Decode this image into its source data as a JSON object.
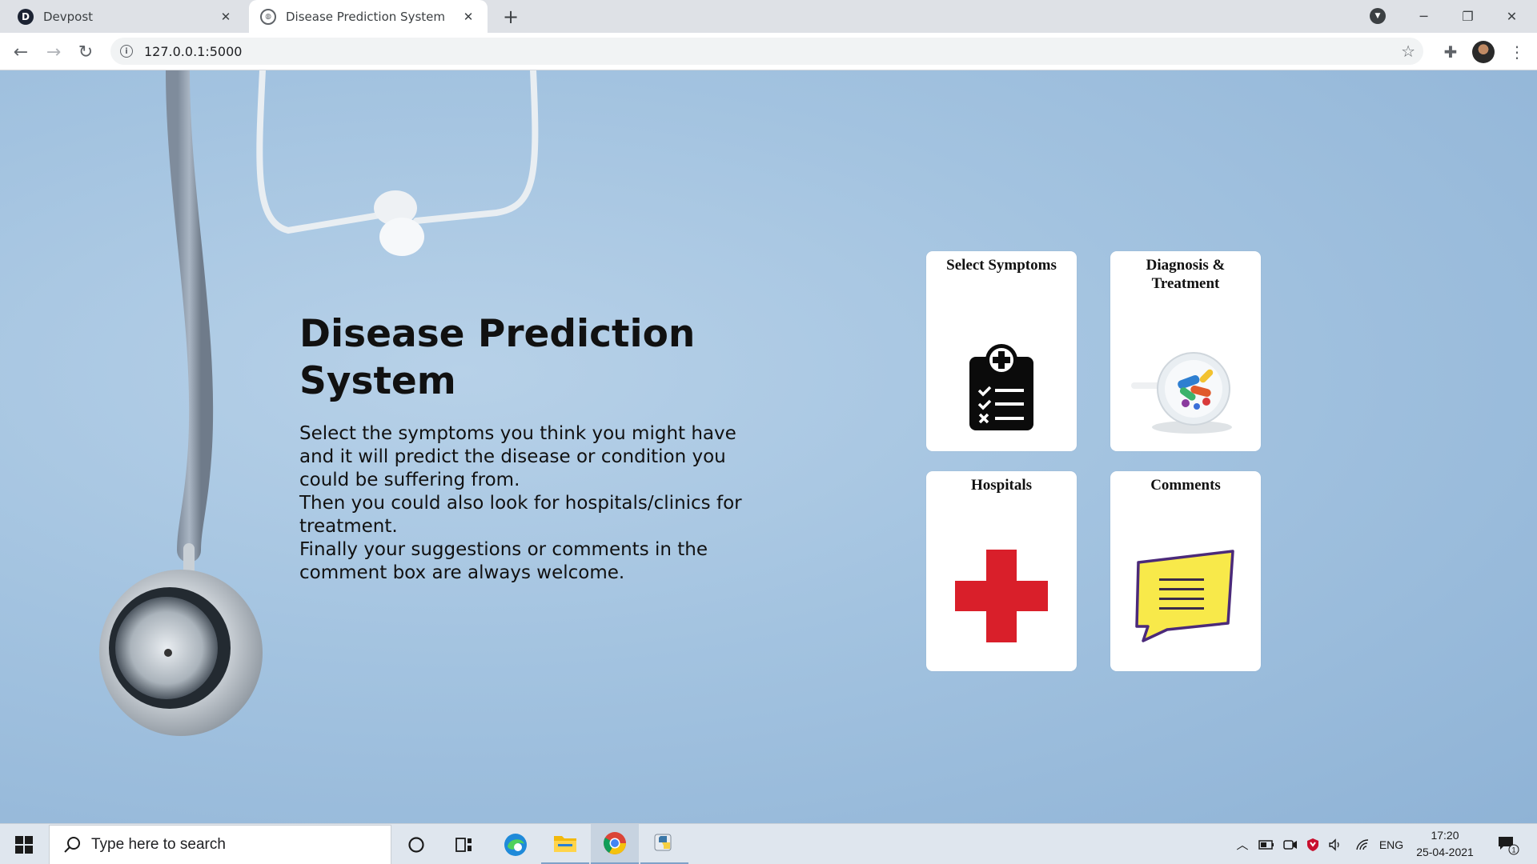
{
  "browser": {
    "tabs": [
      {
        "title": "Devpost",
        "favicon_letter": "D",
        "active": false
      },
      {
        "title": "Disease Prediction System",
        "active": true
      }
    ],
    "url": "127.0.0.1:5000"
  },
  "page": {
    "title": "Disease Prediction System",
    "description": "Select the symptoms you think you might have and it will predict the disease or condition you could be suffering from.\nThen you could also look for hospitals/clinics for treatment.\nFinally your suggestions or comments in the comment box are always welcome.",
    "cards": [
      {
        "title": "Select Symptoms",
        "icon": "clipboard-checklist-icon"
      },
      {
        "title": "Diagnosis & Treatment",
        "icon": "pills-bowl-icon"
      },
      {
        "title": "Hospitals",
        "icon": "red-cross-icon"
      },
      {
        "title": "Comments",
        "icon": "speech-bubble-icon"
      }
    ]
  },
  "taskbar": {
    "search_placeholder": "Type here to search",
    "language": "ENG",
    "time": "17:20",
    "date": "25-04-2021",
    "notification_count": "1"
  },
  "colors": {
    "page_background": "#a3c3e0",
    "hospital_cross": "#d91f2a",
    "comment_bubble": "#f8e94a",
    "comment_outline": "#4b2a7a"
  }
}
